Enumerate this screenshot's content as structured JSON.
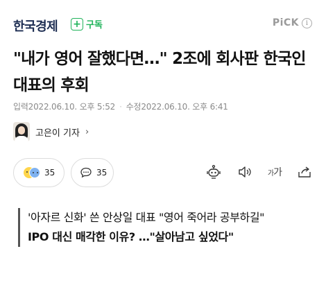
{
  "header": {
    "logo": "한국경제",
    "subscribe_label": "구독",
    "pick_label": "PiCK"
  },
  "article": {
    "headline": "\"내가 영어 잘했다면…\" 2조에 회사판 한국인 대표의 후회",
    "published": "입력2022.06.10. 오후 5:52",
    "modified": "수정2022.06.10. 오후 6:41",
    "reporter": "고은이 기자",
    "reactions_count": "35",
    "comments_count": "35",
    "font_size_label_small": "가",
    "font_size_label_large": "가",
    "subheads": [
      "'아자르 신화' 쓴 안상일 대표 \"영어 죽어라 공부하길\"",
      "IPO 대신 매각한 이유? …\"살아남고 싶었다\""
    ]
  },
  "colors": {
    "accent_green": "#1fb35a",
    "logo_navy": "#1d2d52",
    "muted_gray": "#8a8a8a"
  },
  "icons": [
    "plus-icon",
    "info-icon",
    "chevron-right-icon",
    "reaction-emoji-icon",
    "comment-bubble-icon",
    "ai-summary-robot-icon",
    "speaker-icon",
    "font-size-icon",
    "share-icon"
  ]
}
